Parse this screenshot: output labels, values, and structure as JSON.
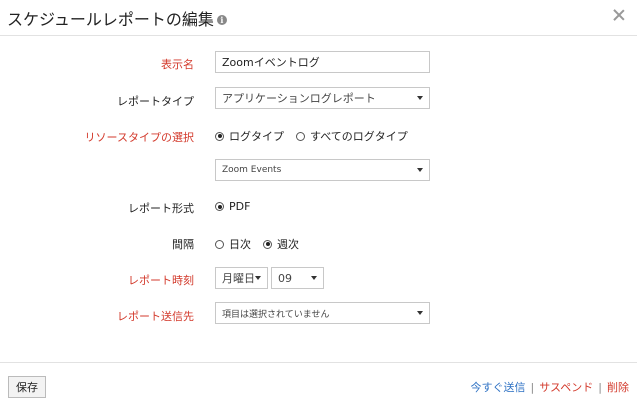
{
  "dialog": {
    "title": "スケジュールレポートの編集",
    "info_icon": "i"
  },
  "fields": {
    "display_name": {
      "label": "表示名",
      "value": "Zoomイベントログ"
    },
    "report_type": {
      "label": "レポートタイプ",
      "value": "アプリケーションログレポート"
    },
    "resource_type": {
      "label": "リソースタイプの選択",
      "options": [
        "ログタイプ",
        "すべてのログタイプ"
      ],
      "selected": "ログタイプ",
      "log_type_value": "Zoom Events"
    },
    "report_format": {
      "label": "レポート形式",
      "option": "PDF"
    },
    "interval": {
      "label": "間隔",
      "options": [
        "日次",
        "週次"
      ],
      "selected": "週次"
    },
    "report_time": {
      "label": "レポート時刻",
      "day": "月曜日",
      "hour": "09"
    },
    "recipients": {
      "label": "レポート送信先",
      "value": "項目は選択されていません"
    }
  },
  "footer": {
    "save_label": "保存",
    "send_now": "今すぐ送信",
    "suspend": "サスペンド",
    "delete": "削除",
    "separator": "|"
  },
  "colors": {
    "required_label": "#d33a2c",
    "link_blue": "#2f72c4",
    "link_red": "#d33a2c"
  }
}
